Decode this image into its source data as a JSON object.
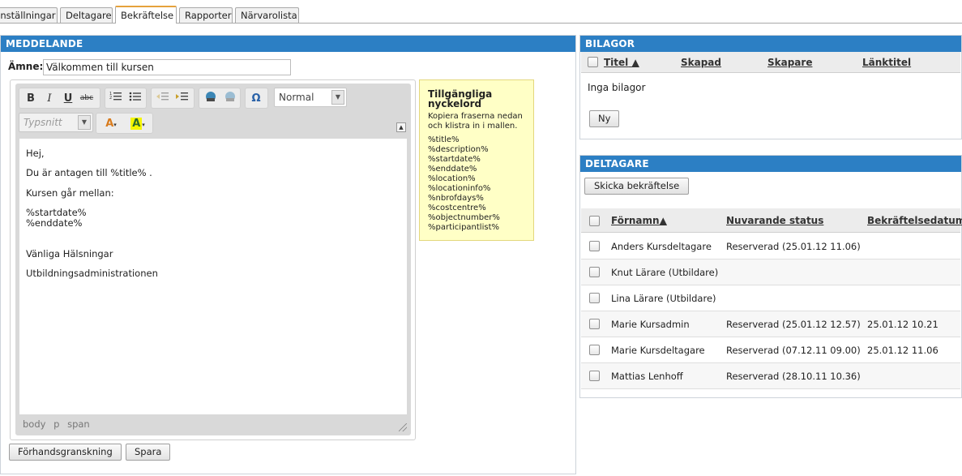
{
  "tabs": [
    "Inställningar",
    "Deltagare",
    "Bekräftelse",
    "Rapporter",
    "Närvarolista"
  ],
  "active_tab": "Bekräftelse",
  "message": {
    "header": "Meddelande",
    "subject_label": "Ämne:",
    "subject_value": "Välkommen till kursen",
    "format_value": "Normal",
    "font_placeholder": "Typsnitt",
    "body_lines": [
      "Hej,",
      "Du är antagen till %title% .",
      "Kursen går mellan:",
      "%startdate%",
      "%enddate%",
      "Vänliga Hälsningar",
      "Utbildningsadministrationen"
    ],
    "path": [
      "body",
      "p",
      "span"
    ],
    "preview_button": "Förhandsgranskning",
    "save_button": "Spara"
  },
  "keywords": {
    "title": "Tillgängliga nyckelord",
    "hint": "Kopiera fraserna nedan och klistra in i mallen.",
    "items": [
      "%title%",
      "%description%",
      "%startdate%",
      "%enddate%",
      "%location%",
      "%locationinfo%",
      "%nbrofdays%",
      "%costcentre%",
      "%objectnumber%",
      "%participantlist%"
    ]
  },
  "attachments": {
    "header": "Bilagor",
    "columns": [
      "Titel",
      "Skapad",
      "Skapare",
      "Länktitel"
    ],
    "empty_text": "Inga bilagor",
    "new_button": "Ny"
  },
  "participants": {
    "header": "Deltagare",
    "send_button": "Skicka bekräftelse",
    "columns": [
      "Förnamn",
      "Nuvarande status",
      "Bekräftelsedatum"
    ],
    "rows": [
      {
        "name": "Anders Kursdeltagare",
        "status": "Reserverad (25.01.12 11.06)",
        "date": ""
      },
      {
        "name": "Knut Lärare (Utbildare)",
        "status": "",
        "date": ""
      },
      {
        "name": "Lina Lärare (Utbildare)",
        "status": "",
        "date": ""
      },
      {
        "name": "Marie Kursadmin",
        "status": "Reserverad (25.01.12 12.57)",
        "date": "25.01.12 10.21"
      },
      {
        "name": "Marie Kursdeltagare",
        "status": "Reserverad (07.12.11 09.00)",
        "date": "25.01.12 11.06"
      },
      {
        "name": "Mattias Lenhoff",
        "status": "Reserverad (28.10.11 10.36)",
        "date": ""
      }
    ]
  },
  "colors": {
    "header_blue": "#2c7fc4",
    "active_tab_accent": "#e6a23c",
    "keyword_bg": "#ffffc6"
  }
}
